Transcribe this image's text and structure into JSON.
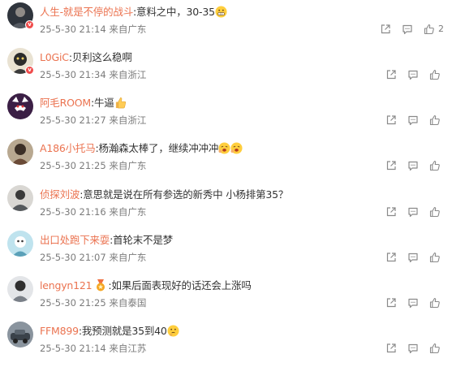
{
  "comments": [
    {
      "username": "人生-就是不停的战斗",
      "text": "意料之中，30-35",
      "emoji": "grimace-emoji",
      "time": "25-5-30 21:14",
      "location": "来自广东",
      "likes": "2",
      "avatar_color": "#3a3f48",
      "verified": true
    },
    {
      "username": "L0GiC",
      "text": "贝利这么稳啊",
      "emoji": "",
      "time": "25-5-30 21:34",
      "location": "来自浙江",
      "likes": "",
      "avatar_color": "#c9a24a",
      "verified": true
    },
    {
      "username": "阿毛ROOM",
      "text": "牛逼",
      "emoji": "thumbs-up-emoji",
      "time": "25-5-30 21:27",
      "location": "来自浙江",
      "likes": "",
      "avatar_color": "#4a2a55",
      "verified": false
    },
    {
      "username": "A186小托马",
      "text": "杨瀚森太棒了，继续冲冲冲",
      "emoji": "cheer-emoji-double",
      "time": "25-5-30 21:25",
      "location": "来自广东",
      "likes": "",
      "avatar_color": "#6a5a48",
      "verified": false
    },
    {
      "username": "侦探刘波",
      "text": "意思就是说在所有参选的新秀中 小杨排第35？",
      "emoji": "",
      "time": "25-5-30 21:16",
      "location": "来自广东",
      "likes": "",
      "avatar_color": "#5a6064",
      "verified": false
    },
    {
      "username": "出口处跑下来耍",
      "text": "首轮末不是梦",
      "emoji": "",
      "time": "25-5-30 21:07",
      "location": "来自广东",
      "likes": "",
      "avatar_color": "#7fb7c8",
      "verified": false
    },
    {
      "username": "lengyn121",
      "text": "如果后面表现好的话还会上涨吗",
      "emoji": "",
      "time": "25-5-30 21:25",
      "location": "来自泰国",
      "likes": "",
      "avatar_color": "#7a8088",
      "verified": false,
      "medal": true
    },
    {
      "username": "FFM899",
      "text": "我预测就是35到40",
      "emoji": "thinking-emoji",
      "time": "25-5-30 21:14",
      "location": "来自江苏",
      "likes": "",
      "avatar_color": "#4f5a66",
      "verified": false
    }
  ],
  "verified_badge_glyph": "v",
  "colors": {
    "username": "#eb7350",
    "text": "#333333",
    "meta": "#7b7b7b",
    "icon": "#8a8a8a"
  }
}
